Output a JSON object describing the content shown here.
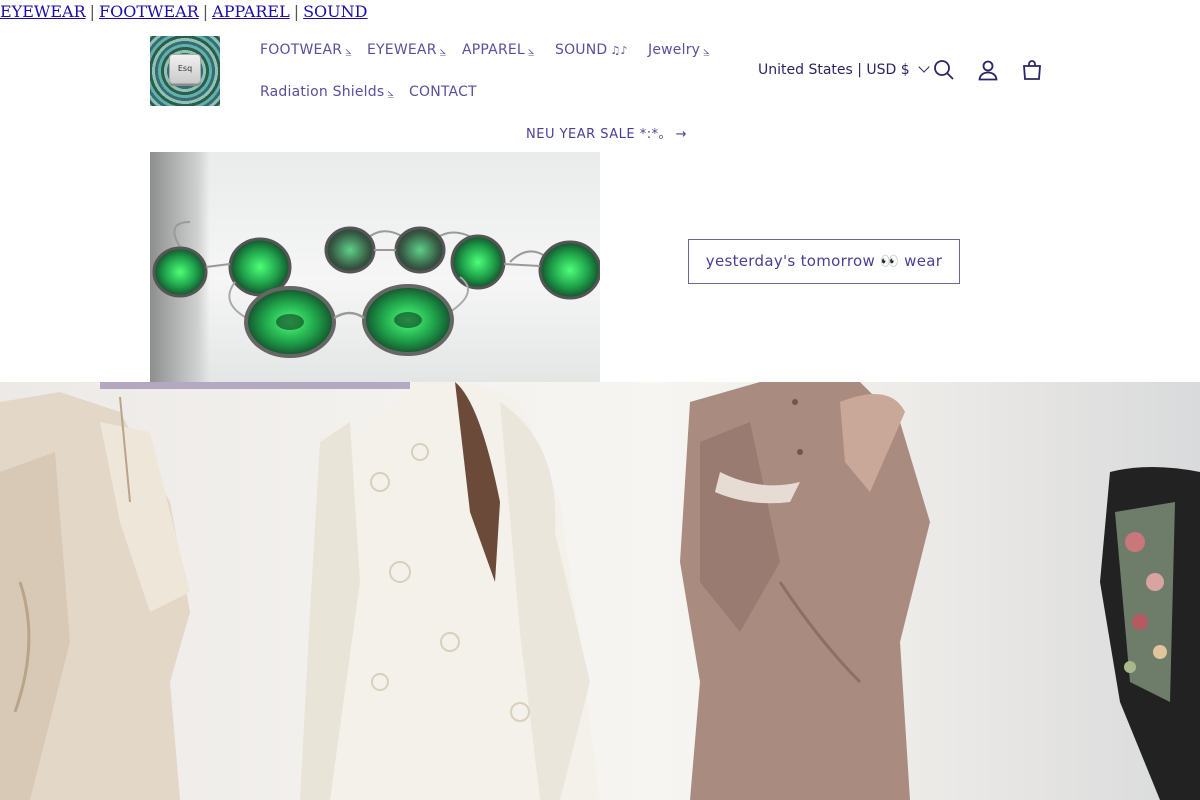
{
  "top_links": [
    "EYEWEAR",
    "FOOTWEAR",
    "APPAREL",
    "SOUND"
  ],
  "top_separator": "|",
  "logo": {
    "key_text": "Esq"
  },
  "nav": {
    "row1": [
      {
        "label": "FOOTWEAR",
        "suffix": "⦥"
      },
      {
        "label": "EYEWEAR",
        "suffix": "⦥"
      },
      {
        "label": "APPAREL",
        "suffix": "⦥"
      },
      {
        "label": "SOUND",
        "suffix": "♫♪"
      },
      {
        "label": "Jewelry",
        "suffix": "⦥"
      }
    ],
    "row2": [
      {
        "label": "Radiation Shields",
        "suffix": "⦥"
      },
      {
        "label": "CONTACT",
        "suffix": ""
      }
    ]
  },
  "locale": "United States | USD $",
  "icons": {
    "search": "search-icon",
    "account": "account-icon",
    "cart": "cart-icon"
  },
  "sale_link": {
    "label": "NEU YEAR SALE *:*｡",
    "arrow": "→"
  },
  "hero": {
    "button_label": "yesterday's tomorrow 👀 wear"
  },
  "colors": {
    "text": "#2b2566",
    "nav": "#5a4f9e",
    "link": "#1a0dab"
  }
}
